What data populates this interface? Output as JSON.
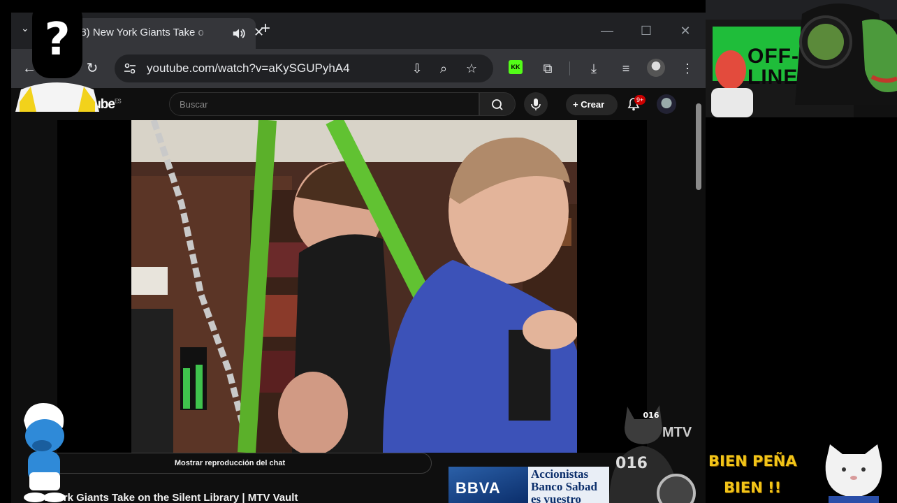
{
  "browser": {
    "tab": {
      "title": "(58) New York Giants Take o",
      "close": "✕"
    },
    "new_tab": "+",
    "window_buttons": {
      "minimize": "—",
      "maximize": "☐",
      "close": "✕"
    },
    "url": "youtube.com/watch?v=aKySGUPyhA4"
  },
  "youtube": {
    "logo": "Tube",
    "logo_country": "ES",
    "search_placeholder": "Buscar",
    "create_label": "Crear",
    "notifications_badge": "9+",
    "chat_replay_label": "Mostrar reproducción del chat",
    "video_title": "New York Giants Take on the Silent Library | MTV Vault",
    "channel_watermark": "MTV"
  },
  "ad": {
    "brand": "BBVA",
    "copy_line1": "Accionistas",
    "copy_line2": "Banco Sabad",
    "copy_line3": "es vuestro"
  },
  "overlays": {
    "offline_text_1": "OFF-",
    "offline_text_2": "LINE",
    "fan_text_1": "BIEN PEÑA",
    "fan_text_2": "BIEN !!",
    "cat_jersey": "016",
    "cat_shield": "016",
    "mystery_mark": "?"
  },
  "colors": {
    "tab_strip": "#202124",
    "toolbar": "#35363a",
    "yt_background": "#0f0f0f",
    "kick_green": "#53fc18",
    "fan_text": "#f2c418",
    "smurf_blue": "#2f8ad8"
  }
}
